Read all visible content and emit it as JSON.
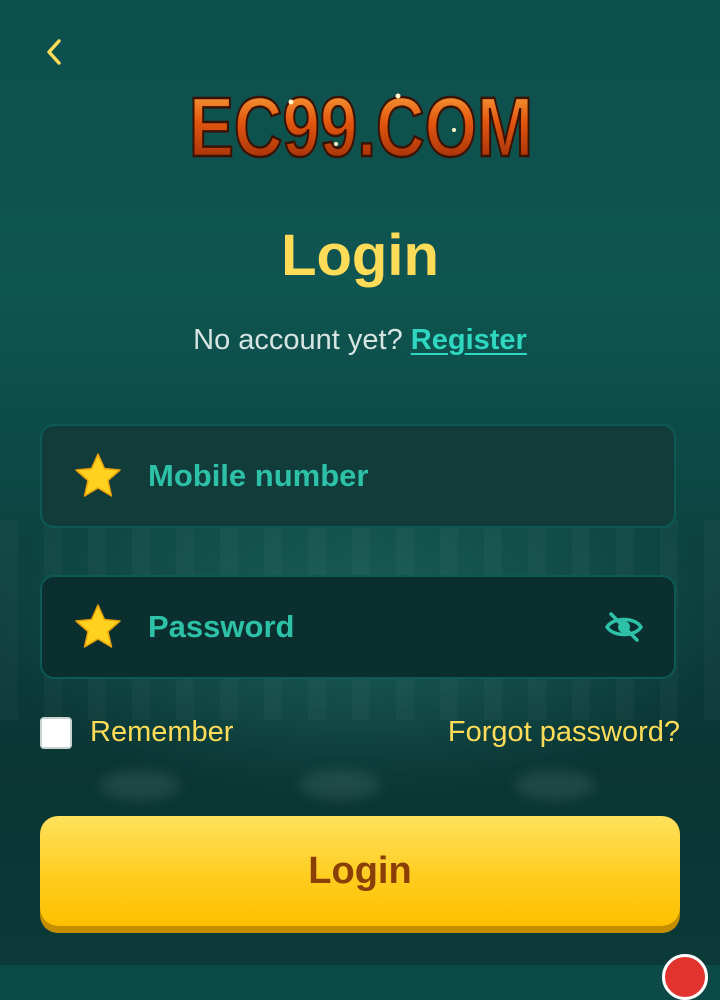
{
  "header": {
    "back_icon": "chevron-left-icon",
    "logo_text": "EC99.COM"
  },
  "login": {
    "title": "Login",
    "no_account_text": "No account yet?",
    "register_link": "Register"
  },
  "form": {
    "mobile": {
      "placeholder": "Mobile number",
      "value": "",
      "icon": "star-icon"
    },
    "password": {
      "placeholder": "Password",
      "value": "",
      "icon": "star-icon",
      "toggle_icon": "eye-off-icon"
    },
    "remember_label": "Remember",
    "remember_checked": false,
    "forgot_link": "Forgot password?",
    "submit_label": "Login"
  },
  "colors": {
    "accent_yellow": "#fedc58",
    "accent_teal": "#2fd7c0",
    "button_text": "#8a3f07",
    "background": "#0c4a47"
  }
}
